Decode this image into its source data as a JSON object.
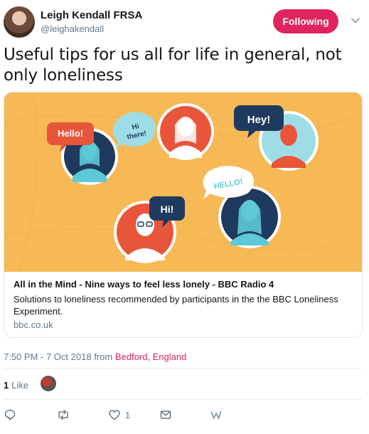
{
  "author": {
    "name": "Leigh Kendall FRSA",
    "handle": "@leighakendall",
    "follow_label": "Following"
  },
  "tweet": {
    "text": "Useful tips for us all for life in general, not only loneliness"
  },
  "card": {
    "image_bubbles": {
      "hello": "Hello!",
      "hi_there_line1": "Hi",
      "hi_there_line2": "there!",
      "hey": "Hey!",
      "hello_caps": "HELLO!",
      "hi": "Hi!"
    },
    "title": "All in the Mind - Nine ways to feel less lonely - BBC Radio 4",
    "description": "Solutions to loneliness recommended by participants in the the BBC Loneliness Experiment.",
    "domain": "bbc.co.uk"
  },
  "meta": {
    "time": "7:50 PM - 7 Oct 2018",
    "from": "from",
    "location": "Bedford, England"
  },
  "stats": {
    "like_count": "1",
    "like_label": "Like"
  },
  "actions": {
    "like_count": "1"
  },
  "colors": {
    "accent": "#e0245e",
    "muted": "#657786",
    "card_bg": "#f6b955"
  }
}
